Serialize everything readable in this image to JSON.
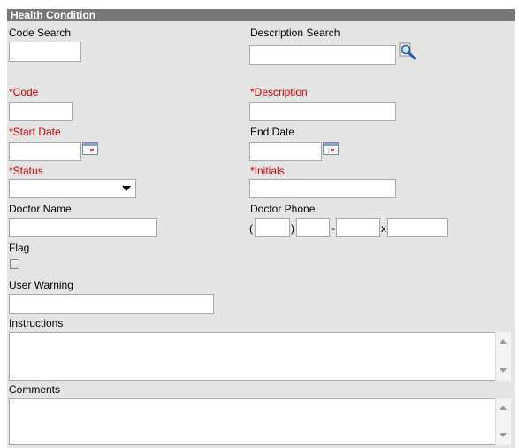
{
  "header": {
    "title": "Health Condition"
  },
  "fields": {
    "code_search": {
      "label": "Code Search",
      "value": ""
    },
    "description_search": {
      "label": "Description Search",
      "value": "",
      "icon": "magnifier-icon"
    },
    "code": {
      "label": "*Code",
      "value": ""
    },
    "description": {
      "label": "*Description",
      "value": ""
    },
    "start_date": {
      "label": "*Start Date",
      "value": ""
    },
    "end_date": {
      "label": "End Date",
      "value": ""
    },
    "status": {
      "label": "*Status",
      "value": ""
    },
    "initials": {
      "label": "*Initials",
      "value": ""
    },
    "doctor_name": {
      "label": "Doctor Name",
      "value": ""
    },
    "doctor_phone": {
      "label": "Doctor Phone",
      "open_paren": "(",
      "close_paren": ")",
      "dash": "-",
      "ext_label": "x"
    },
    "flag": {
      "label": "Flag",
      "checked": false
    },
    "user_warning": {
      "label": "User Warning",
      "value": ""
    },
    "instructions": {
      "label": "Instructions",
      "value": ""
    },
    "comments": {
      "label": "Comments",
      "value": ""
    }
  },
  "colors": {
    "required": "#d40000",
    "header_bg": "#777777",
    "panel_bg": "#e4e4e4"
  }
}
